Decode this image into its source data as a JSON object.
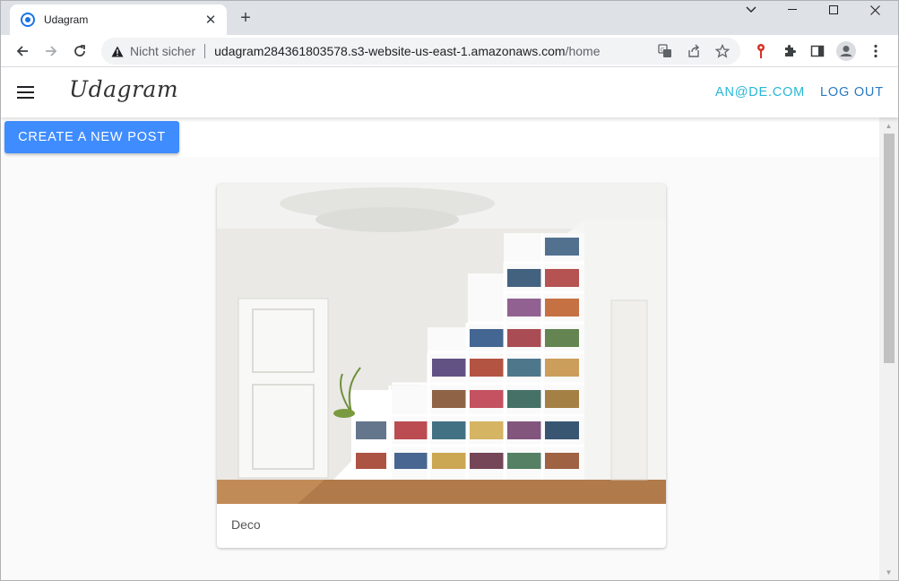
{
  "browser": {
    "tab_title": "Udagram",
    "tab_close": "✕",
    "new_tab": "+",
    "security_label": "Nicht sicher",
    "url_host": "udagram284361803578.s3-website-us-east-1.amazonaws.com",
    "url_path": "/home"
  },
  "app": {
    "logo": "Udagram",
    "user_email": "AN@DE.COM",
    "logout_label": "LOG OUT",
    "create_post_label": "CREATE A NEW POST",
    "accent_color": "#26b7d6",
    "primary_button_color": "#3f8cff"
  },
  "feed": {
    "posts": [
      {
        "caption": "Deco"
      }
    ]
  }
}
